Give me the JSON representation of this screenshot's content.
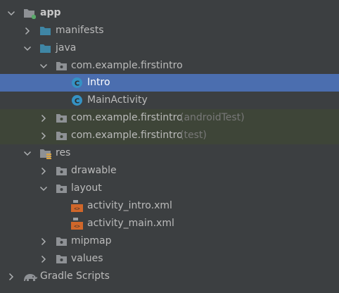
{
  "tree": {
    "app": "app",
    "manifests": "manifests",
    "java": "java",
    "pkg_main": "com.example.firstintro",
    "intro": "Intro",
    "main_activity": "MainActivity",
    "pkg_android_test": "com.example.firstintro",
    "pkg_android_test_suffix": "(androidTest)",
    "pkg_test": "com.example.firstintro",
    "pkg_test_suffix": "(test)",
    "res": "res",
    "drawable": "drawable",
    "layout": "layout",
    "activity_intro": "activity_intro.xml",
    "activity_main": "activity_main.xml",
    "mipmap": "mipmap",
    "values": "values",
    "gradle_scripts": "Gradle Scripts"
  },
  "colors": {
    "background": "#3c3f41",
    "selection": "#4b6eaf",
    "test_highlight": "#3e4538",
    "folder_blue": "#3f86a5",
    "folder_gray": "#8e9195",
    "class_icon": "#3592c4",
    "xml_icon": "#d0672a"
  },
  "icons": {
    "module": "module-folder-icon",
    "source_folder": "source-folder-icon",
    "package": "package-icon",
    "class": "class-icon",
    "resources": "resources-folder-icon",
    "xml": "xml-layout-file-icon",
    "gradle": "gradle-elephant-icon"
  }
}
